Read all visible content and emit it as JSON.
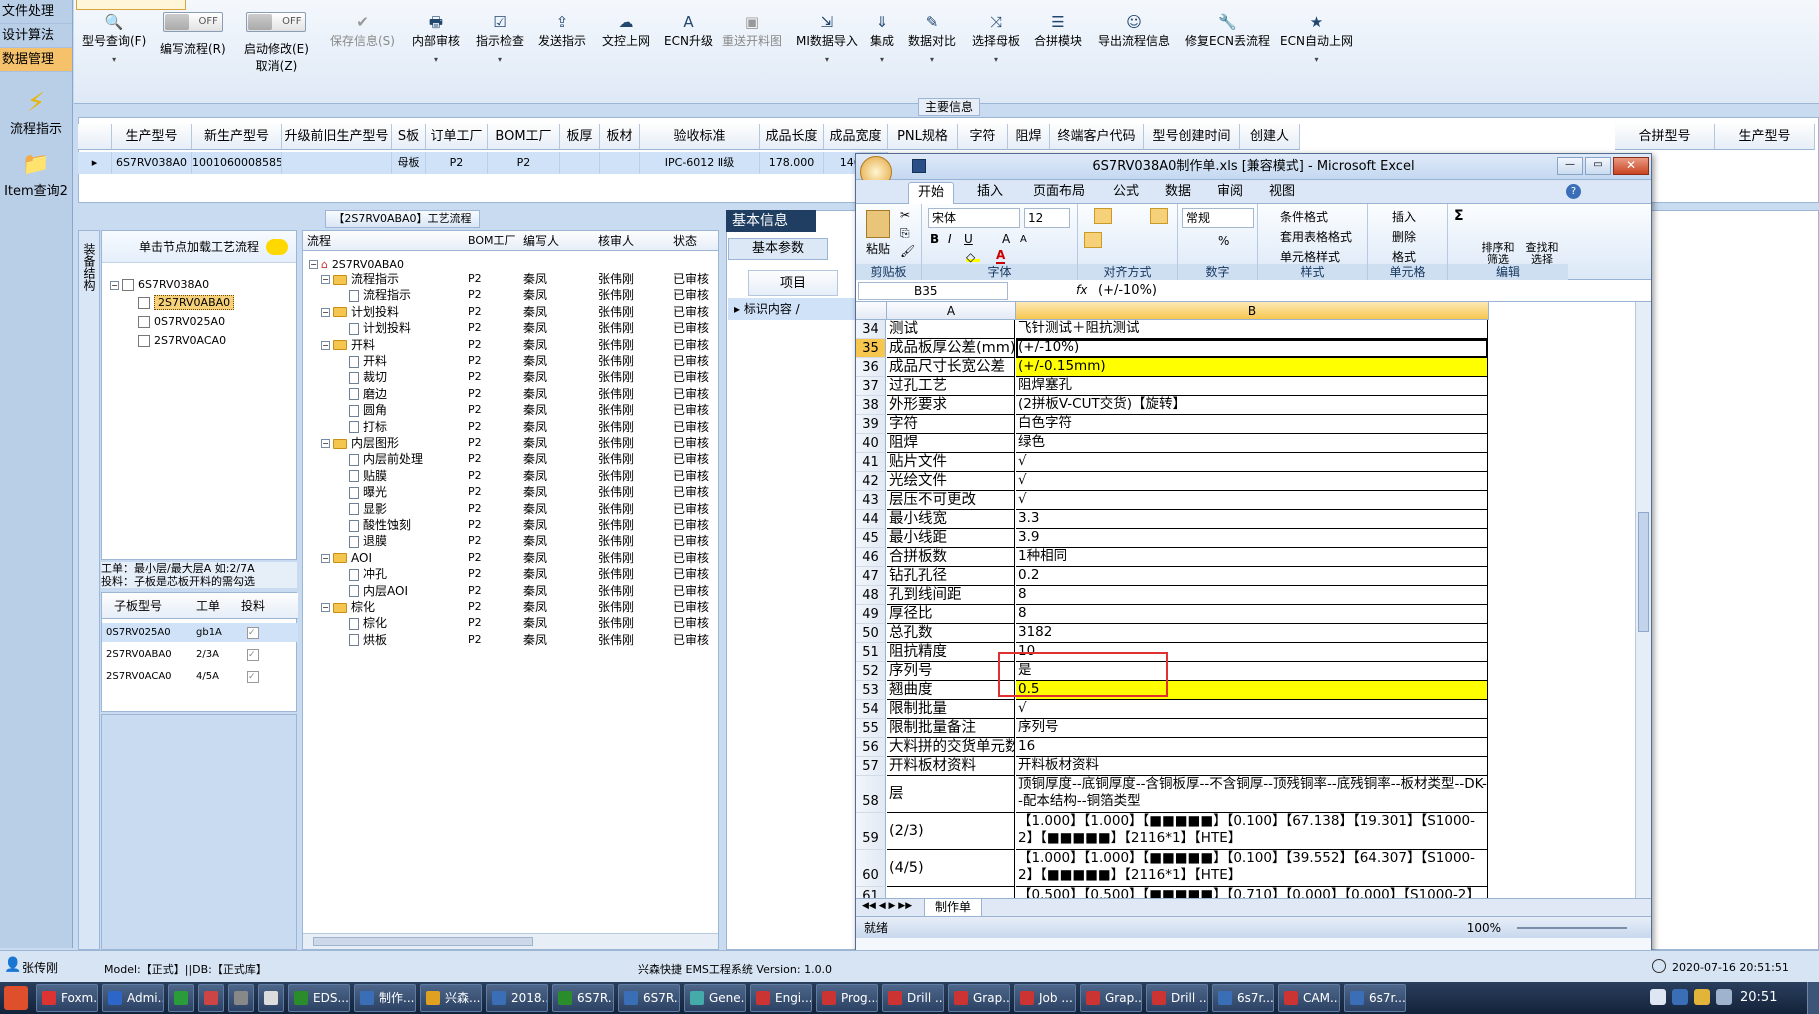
{
  "nav": {
    "items": [
      "文件处理",
      "设计算法",
      "数据管理"
    ],
    "tiles": [
      "流程指示",
      "Item查询2"
    ]
  },
  "toolbar": {
    "buttons": [
      {
        "label": "型号查询(F)",
        "icon": "🔍",
        "dd": "▾"
      },
      {
        "label": "编写流程(R)"
      },
      {
        "label": "启动修改(E)",
        "sub": "取消(Z)"
      },
      {
        "label": "保存信息(S)",
        "icon": "✔",
        "disabled": true
      },
      {
        "label": "内部审核",
        "icon": "🖶",
        "dd": "▾"
      },
      {
        "label": "指示检查",
        "icon": "☑",
        "dd": "▾"
      },
      {
        "label": "发送指示",
        "icon": "⇪"
      },
      {
        "label": "文控上网",
        "icon": "☁"
      },
      {
        "label": "ECN升级",
        "icon": "A"
      },
      {
        "label": "重送开料图",
        "icon": "▣",
        "disabled": true
      },
      {
        "label": "MI数据导入",
        "icon": "⇲",
        "dd": "▾"
      },
      {
        "label": "集成",
        "icon": "⇓",
        "dd": "▾"
      },
      {
        "label": "数据对比",
        "icon": "✎",
        "dd": "▾"
      },
      {
        "label": "选择母板",
        "icon": "⤨",
        "dd": "▾"
      },
      {
        "label": "合拼模块",
        "icon": "☰"
      },
      {
        "label": "导出流程信息",
        "icon": "☺"
      },
      {
        "label": "修复ECN丢流程",
        "icon": "🔧"
      },
      {
        "label": "ECN自动上网",
        "icon": "★",
        "dd": "▾"
      }
    ],
    "toggle_text": "OFF",
    "section_label": "主要信息"
  },
  "main_grid": {
    "headers": [
      "生产型号",
      "新生产型号",
      "升级前旧生产型号",
      "S板",
      "订单工厂",
      "BOM工厂",
      "板厚",
      "板材",
      "验收标准",
      "成品长度",
      "成品宽度",
      "PNL规格",
      "字符",
      "阻焊",
      "终端客户代码",
      "型号创建时间",
      "创建人"
    ],
    "row": [
      "6S7RV038A0",
      "10010600085855",
      "",
      "母板",
      "P2",
      "P2",
      "",
      "",
      "IPC-6012 Ⅱ级",
      "178.000",
      "146.0",
      "",
      "",
      "",
      "",
      "",
      ""
    ],
    "right_headers": [
      "合拼型号",
      "生产型号"
    ]
  },
  "left_panel": {
    "title": "单击节点加载工艺流程",
    "side_tab": "装备结构",
    "tree": [
      "6S7RV038A0",
      "2S7RV0ABA0",
      "0S7RV025A0",
      "2S7RV0ACA0"
    ],
    "note_line1": "工单：最小层/最大层A 如:2/7A",
    "note_line2": "投料：子板是芯板开料的需勾选",
    "sub_headers": [
      "子板型号",
      "工单",
      "投料"
    ],
    "sub_rows": [
      [
        "0S7RV025A0",
        "gb1A"
      ],
      [
        "2S7RV0ABA0",
        "2/3A"
      ],
      [
        "2S7RV0ACA0",
        "4/5A"
      ]
    ]
  },
  "flow_panel": {
    "title": "【2S7RV0ABA0】工艺流程",
    "headers": [
      "流程",
      "BOM工厂",
      "编写人",
      "核审人",
      "状态"
    ],
    "root": "2S7RV0ABA0",
    "rows": [
      {
        "name": "流程指示",
        "lvl": 1,
        "folder": true
      },
      {
        "name": "流程指示",
        "lvl": 2
      },
      {
        "name": "计划投料",
        "lvl": 1,
        "folder": true
      },
      {
        "name": "计划投料",
        "lvl": 2
      },
      {
        "name": "开料",
        "lvl": 1,
        "folder": true
      },
      {
        "name": "开料",
        "lvl": 2
      },
      {
        "name": "裁切",
        "lvl": 2
      },
      {
        "name": "磨边",
        "lvl": 2
      },
      {
        "name": "圆角",
        "lvl": 2
      },
      {
        "name": "打标",
        "lvl": 2
      },
      {
        "name": "内层图形",
        "lvl": 1,
        "folder": true
      },
      {
        "name": "内层前处理",
        "lvl": 2
      },
      {
        "name": "贴膜",
        "lvl": 2
      },
      {
        "name": "曝光",
        "lvl": 2
      },
      {
        "name": "显影",
        "lvl": 2
      },
      {
        "name": "酸性蚀刻",
        "lvl": 2
      },
      {
        "name": "退膜",
        "lvl": 2
      },
      {
        "name": "AOI",
        "lvl": 1,
        "folder": true
      },
      {
        "name": "冲孔",
        "lvl": 2
      },
      {
        "name": "内层AOI",
        "lvl": 2
      },
      {
        "name": "棕化",
        "lvl": 1,
        "folder": true
      },
      {
        "name": "棕化",
        "lvl": 2
      },
      {
        "name": "烘板",
        "lvl": 2
      }
    ],
    "bom": "P2",
    "author": "秦凤",
    "reviewer": "张伟刚",
    "status": "已审核"
  },
  "info_panel": {
    "tab1": "基本信息",
    "tab2": "基本参数",
    "col": "项目",
    "row": "标识内容"
  },
  "excel": {
    "title": "6S7RV038A0制作单.xls  [兼容模式] - Microsoft Excel",
    "tabs": [
      "开始",
      "插入",
      "页面布局",
      "公式",
      "数据",
      "审阅",
      "视图"
    ],
    "groups": [
      "剪贴板",
      "字体",
      "对齐方式",
      "数字",
      "样式",
      "单元格",
      "编辑"
    ],
    "font_name": "宋体",
    "font_size": "12",
    "number_format": "常规",
    "style_items": [
      "条件格式",
      "套用表格格式",
      "单元格样式"
    ],
    "cell_items": [
      "插入",
      "删除",
      "格式"
    ],
    "edit_items": [
      "排序和筛选",
      "查找和选择"
    ],
    "paste": "粘贴",
    "namebox": "B35",
    "formula": "(+/-10%)",
    "col_a": "A",
    "col_b": "B",
    "rows": [
      {
        "n": "34",
        "a": "测试",
        "b": "飞针测试＋阻抗测试"
      },
      {
        "n": "35",
        "a": "成品板厚公差(mm)",
        "b": "(+/-10%)",
        "active": true
      },
      {
        "n": "36",
        "a": "成品尺寸长宽公差",
        "b": "(+/-0.15mm)",
        "y": true
      },
      {
        "n": "37",
        "a": "过孔工艺",
        "b": "阻焊塞孔"
      },
      {
        "n": "38",
        "a": "外形要求",
        "b": "(2拼板V-CUT交货)【旋转】"
      },
      {
        "n": "39",
        "a": "字符",
        "b": "白色字符"
      },
      {
        "n": "40",
        "a": "阻焊",
        "b": "绿色"
      },
      {
        "n": "41",
        "a": "贴片文件",
        "b": "√"
      },
      {
        "n": "42",
        "a": "光绘文件",
        "b": "√"
      },
      {
        "n": "43",
        "a": "层压不可更改",
        "b": "√"
      },
      {
        "n": "44",
        "a": "最小线宽",
        "b": "3.3"
      },
      {
        "n": "45",
        "a": "最小线距",
        "b": "3.9"
      },
      {
        "n": "46",
        "a": "合拼板数",
        "b": "1种相同"
      },
      {
        "n": "47",
        "a": "钻孔孔径",
        "b": "0.2"
      },
      {
        "n": "48",
        "a": "孔到线间距",
        "b": "8"
      },
      {
        "n": "49",
        "a": "厚径比",
        "b": "8"
      },
      {
        "n": "50",
        "a": "总孔数",
        "b": "3182"
      },
      {
        "n": "51",
        "a": "阻抗精度",
        "b": "10"
      },
      {
        "n": "52",
        "a": "序列号",
        "b": "是"
      },
      {
        "n": "53",
        "a": "翘曲度",
        "b": "0.5",
        "y": true
      },
      {
        "n": "54",
        "a": "限制批量",
        "b": "√"
      },
      {
        "n": "55",
        "a": "限制批量备注",
        "b": "序列号"
      },
      {
        "n": "56",
        "a": "大料拼的交货单元数",
        "b": "16"
      },
      {
        "n": "57",
        "a": "开料板材资料",
        "b": "开料板材资料"
      },
      {
        "n": "58",
        "a": "层",
        "b": "顶铜厚度--底铜厚度--含铜板厚--不含铜厚--顶残铜率--底残铜率--板材类型--DK--配本结构--铜箔类型",
        "tall": true
      },
      {
        "n": "59",
        "a": "(2/3)",
        "b": "【1.000】【1.000】【■■■■■】【0.100】【67.138】【19.301】【S1000-2】【■■■■■】【2116*1】【HTE】",
        "tall": true
      },
      {
        "n": "60",
        "a": "(4/5)",
        "b": "【1.000】【1.000】【■■■■■】【0.100】【39.552】【64.307】【S1000-2】【■■■■■】【2116*1】【HTE】",
        "tall": true
      },
      {
        "n": "61",
        "a": "",
        "b": "【0.500】【0.500】【■■■■■】【0.710】【0.000】【0.000】【S1000-2】"
      }
    ],
    "sheet_tab": "制作单",
    "status": "就绪",
    "zoom": "100%"
  },
  "statusbar": {
    "user": "张传刚",
    "model": "Model:【正式】||DB:【正式库】",
    "company": "兴森快捷  EMS工程系统  Version: 1.0.0",
    "datetime": "2020-07-16  20:51:51"
  },
  "taskbar": {
    "buttons": [
      "Foxm...",
      "Admi...",
      "",
      "",
      "",
      "",
      "EDS...",
      "制作...",
      "兴森...",
      "2018...",
      "6S7R...",
      "6S7R...",
      "Gene...",
      "Engi...",
      "Prog...",
      "Drill ...",
      "Grap...",
      "Job ...",
      "Grap...",
      "Drill ...",
      "6s7r...",
      "CAM...",
      "6s7r..."
    ],
    "clock": "20:51"
  }
}
